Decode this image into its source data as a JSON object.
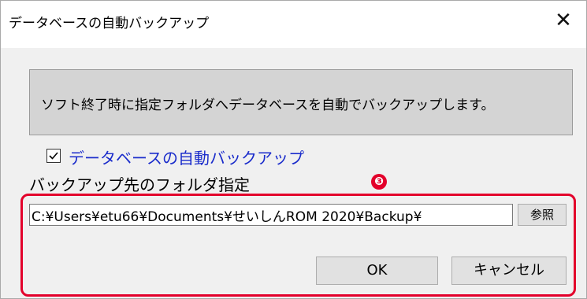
{
  "window": {
    "title": "データベースの自動バックアップ",
    "close_glyph": "✕"
  },
  "info": {
    "text": "ソフト終了時に指定フォルダへデータベースを自動でバックアップします。"
  },
  "auto_backup": {
    "label": "データベースの自動バックアップ",
    "checked": true
  },
  "folder": {
    "label": "バックアップ先のフォルダ指定",
    "value": "C:¥Users¥etu66¥Documents¥せいしんROM 2020¥Backup¥",
    "browse_label": "参照"
  },
  "annotation": {
    "badge": "❸",
    "color": "#e3002b"
  },
  "buttons": {
    "ok": "OK",
    "cancel": "キャンセル"
  }
}
